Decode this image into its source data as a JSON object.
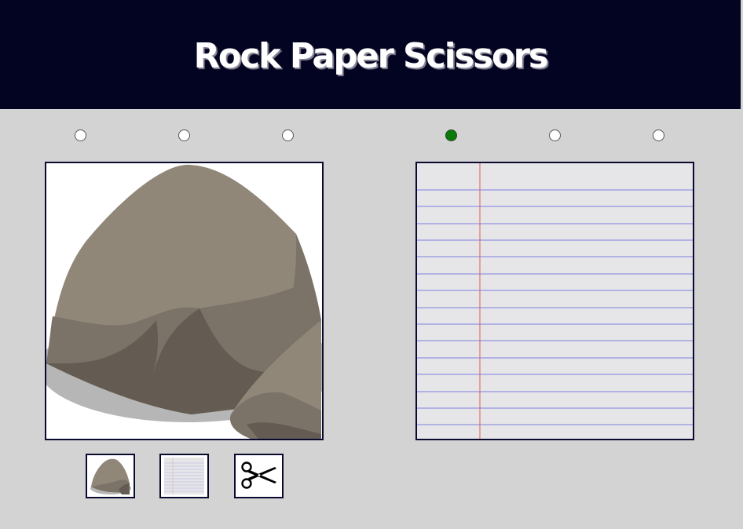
{
  "header": {
    "title": "Rock Paper Scissors"
  },
  "player_choices": [
    {
      "icon": "radio",
      "selected": false
    },
    {
      "icon": "radio",
      "selected": false
    },
    {
      "icon": "radio",
      "selected": false
    }
  ],
  "computer_choices": [
    {
      "icon": "radio",
      "selected": true
    },
    {
      "icon": "radio",
      "selected": false
    },
    {
      "icon": "radio",
      "selected": false
    }
  ],
  "player_panel": {
    "icon": "rock-image"
  },
  "computer_panel": {
    "icon": "paper-image"
  },
  "thumbnails": [
    {
      "icon": "rock-icon"
    },
    {
      "icon": "paper-icon"
    },
    {
      "icon": "scissors-icon"
    }
  ],
  "colors": {
    "header_bg": "#030322",
    "page_bg": "#d3d3d3",
    "selected_radio": "#0b7a0b",
    "rock_light": "#918779",
    "rock_mid": "#7b7368",
    "rock_dark": "#645c53",
    "paper_line": "#5a5ae0",
    "paper_margin": "#e05a5a"
  }
}
